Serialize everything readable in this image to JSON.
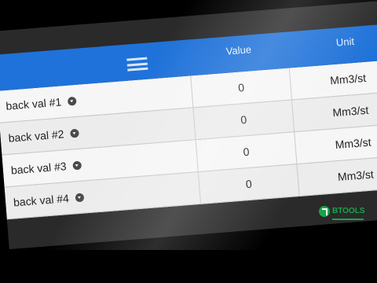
{
  "table": {
    "columns": {
      "param": "",
      "value": "Value",
      "unit": "Unit"
    },
    "rows": [
      {
        "param": "back val #1",
        "value": "0",
        "unit": "Mm3/st"
      },
      {
        "param": "back val #2",
        "value": "0",
        "unit": "Mm3/st"
      },
      {
        "param": "back val #3",
        "value": "0",
        "unit": "Mm3/st"
      },
      {
        "param": "back val #4",
        "value": "0",
        "unit": "Mm3/st"
      }
    ]
  },
  "watermark": {
    "brand": "BTOOLS"
  },
  "colors": {
    "header": "#1f72d9",
    "row": "#ececec",
    "brand": "#1aa34a"
  }
}
